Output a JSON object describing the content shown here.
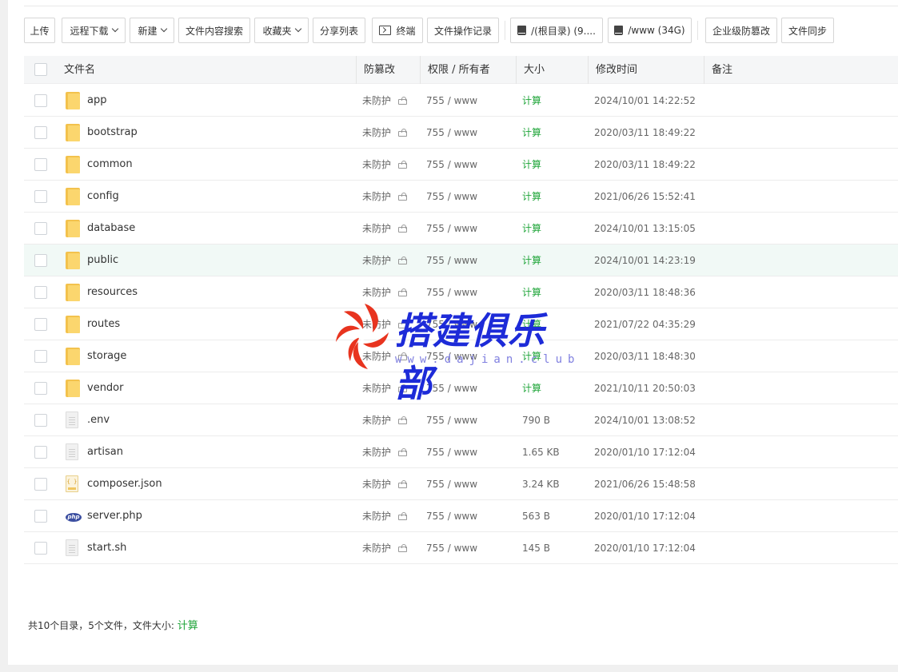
{
  "toolbar": {
    "upload": "上传",
    "remote_download": "远程下载",
    "new": "新建",
    "content_search": "文件内容搜索",
    "favorites": "收藏夹",
    "share_list": "分享列表",
    "terminal": "终端",
    "file_log": "文件操作记录",
    "disk_root": "/(根目录) (9....",
    "disk_www": "/www (34G)",
    "enterprise_protect": "企业级防篡改",
    "file_sync": "文件同步"
  },
  "table": {
    "headers": {
      "name": "文件名",
      "protect": "防篡改",
      "perm": "权限 / 所有者",
      "size": "大小",
      "mtime": "修改时间",
      "note": "备注"
    },
    "rows": [
      {
        "name": "app",
        "type": "folder",
        "protect": "未防护",
        "perm": "755 / www",
        "size": "计算",
        "mtime": "2024/10/01 14:22:52"
      },
      {
        "name": "bootstrap",
        "type": "folder",
        "protect": "未防护",
        "perm": "755 / www",
        "size": "计算",
        "mtime": "2020/03/11 18:49:22"
      },
      {
        "name": "common",
        "type": "folder",
        "protect": "未防护",
        "perm": "755 / www",
        "size": "计算",
        "mtime": "2020/03/11 18:49:22"
      },
      {
        "name": "config",
        "type": "folder",
        "protect": "未防护",
        "perm": "755 / www",
        "size": "计算",
        "mtime": "2021/06/26 15:52:41"
      },
      {
        "name": "database",
        "type": "folder",
        "protect": "未防护",
        "perm": "755 / www",
        "size": "计算",
        "mtime": "2024/10/01 13:15:05"
      },
      {
        "name": "public",
        "type": "folder",
        "protect": "未防护",
        "perm": "755 / www",
        "size": "计算",
        "mtime": "2024/10/01 14:23:19"
      },
      {
        "name": "resources",
        "type": "folder",
        "protect": "未防护",
        "perm": "755 / www",
        "size": "计算",
        "mtime": "2020/03/11 18:48:36"
      },
      {
        "name": "routes",
        "type": "folder",
        "protect": "未防护",
        "perm": "755 / www",
        "size": "计算",
        "mtime": "2021/07/22 04:35:29"
      },
      {
        "name": "storage",
        "type": "folder",
        "protect": "未防护",
        "perm": "755 / www",
        "size": "计算",
        "mtime": "2020/03/11 18:48:30"
      },
      {
        "name": "vendor",
        "type": "folder",
        "protect": "未防护",
        "perm": "755 / www",
        "size": "计算",
        "mtime": "2021/10/11 20:50:03"
      },
      {
        "name": ".env",
        "type": "file",
        "protect": "未防护",
        "perm": "755 / www",
        "size": "790 B",
        "mtime": "2024/10/01 13:08:52"
      },
      {
        "name": "artisan",
        "type": "file",
        "protect": "未防护",
        "perm": "755 / www",
        "size": "1.65 KB",
        "mtime": "2020/01/10 17:12:04"
      },
      {
        "name": "composer.json",
        "type": "json",
        "protect": "未防护",
        "perm": "755 / www",
        "size": "3.24 KB",
        "mtime": "2021/06/26 15:48:58"
      },
      {
        "name": "server.php",
        "type": "php",
        "protect": "未防护",
        "perm": "755 / www",
        "size": "563 B",
        "mtime": "2020/01/10 17:12:04"
      },
      {
        "name": "start.sh",
        "type": "file",
        "protect": "未防护",
        "perm": "755 / www",
        "size": "145 B",
        "mtime": "2020/01/10 17:12:04"
      }
    ]
  },
  "footer": {
    "summary": "共10个目录，5个文件，文件大小:",
    "calc": "计算"
  },
  "watermark": {
    "title": "搭建俱乐部",
    "url": "www.dajian.club"
  },
  "colors": {
    "accent": "#20a53a",
    "highlight_row": "#f1f9f6",
    "watermark_blue": "#1d2bd8",
    "watermark_red": "#e8341f"
  }
}
